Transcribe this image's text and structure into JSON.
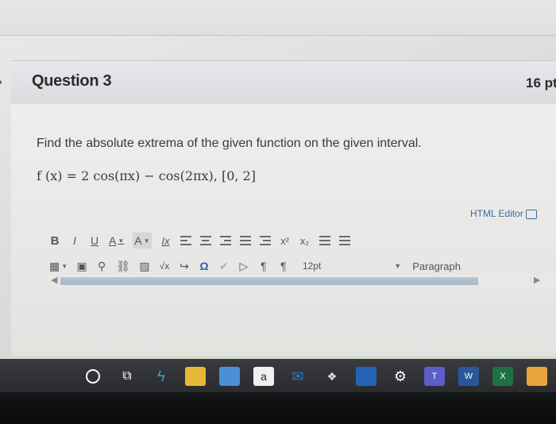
{
  "question": {
    "title": "Question 3",
    "points": "16 pt",
    "prompt": "Find the absolute extrema of the given function on the given interval.",
    "formula": "f (x) = 2 cos(πx) − cos(2πx),  [0, 2]"
  },
  "editor": {
    "html_editor_label": "HTML Editor",
    "toolbar_row1": [
      {
        "name": "bold",
        "label": "B"
      },
      {
        "name": "italic",
        "label": "I"
      },
      {
        "name": "underline",
        "label": "U"
      },
      {
        "name": "font-color",
        "label": "A"
      },
      {
        "name": "background-color",
        "label": "A"
      },
      {
        "name": "clear-formatting",
        "label": "Ix"
      },
      {
        "name": "align-left",
        "label": ""
      },
      {
        "name": "align-center",
        "label": ""
      },
      {
        "name": "align-right",
        "label": ""
      },
      {
        "name": "indent",
        "label": ""
      },
      {
        "name": "outdent",
        "label": ""
      },
      {
        "name": "superscript",
        "label": "x²"
      },
      {
        "name": "subscript",
        "label": "x₂"
      },
      {
        "name": "bullet-list",
        "label": ""
      },
      {
        "name": "numbered-list",
        "label": ""
      }
    ],
    "toolbar_row2": {
      "font_size": "12pt",
      "format": "Paragraph"
    }
  },
  "taskbar": {
    "icons": [
      "cortana-icon",
      "task-view-icon",
      "bolt-icon",
      "file-explorer-icon",
      "store-icon",
      "amazon-icon",
      "mail-icon",
      "dropbox-icon",
      "sticky-notes-icon",
      "settings-icon",
      "teams-icon",
      "word-icon",
      "excel-icon",
      "app-icon"
    ]
  }
}
